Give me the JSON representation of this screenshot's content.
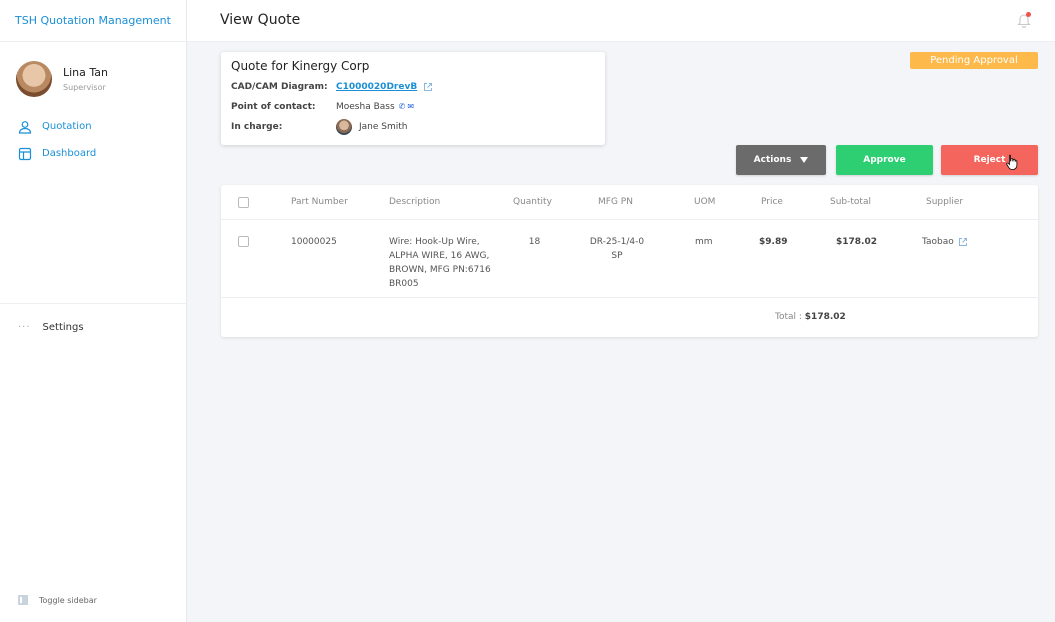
{
  "app": {
    "title": "TSH Quotation Management"
  },
  "user": {
    "name": "Lina Tan",
    "role": "Supervisor"
  },
  "nav": {
    "items": [
      {
        "label": "Quotation",
        "icon": "user-icon"
      },
      {
        "label": "Dashboard",
        "icon": "layout-icon"
      }
    ]
  },
  "settings": {
    "dots": "···",
    "label": "Settings"
  },
  "toggle": {
    "label": "Toggle sidebar"
  },
  "header": {
    "title": "View Quote"
  },
  "quote": {
    "title": "Quote for Kinergy Corp",
    "cad_label": "CAD/CAM Diagram:",
    "cad_value": "C1000020DrevB",
    "contact_label": "Point of contact:",
    "contact_value": "Moesha Bass",
    "incharge_label": "In charge:",
    "incharge_value": "Jane Smith"
  },
  "status": {
    "label": "Pending Approval",
    "color": "#fdb94a"
  },
  "actions": {
    "actions_label": "Actions",
    "approve_label": "Approve",
    "reject_label": "Reject"
  },
  "table": {
    "headers": [
      "Part Number",
      "Description",
      "Quantity",
      "MFG PN",
      "UOM",
      "Price",
      "Sub-total",
      "Supplier"
    ],
    "rows": [
      {
        "part_number": "10000025",
        "description": [
          "Wire: Hook-Up  Wire,",
          "ALPHA WIRE, 16 AWG,",
          "BROWN, MFG PN:6716",
          "BR005"
        ],
        "quantity": "18",
        "mfg_pn": [
          "DR-25-1/4-0",
          "SP"
        ],
        "uom": "mm",
        "price": "$9.89",
        "subtotal": "$178.02",
        "supplier": "Taobao"
      }
    ],
    "total_label": "Total :",
    "total_value": "$178.02"
  },
  "colors": {
    "accent": "#1a8fd6",
    "approve": "#2ecf72",
    "reject": "#f3655d",
    "actions": "#6b6b6b"
  }
}
